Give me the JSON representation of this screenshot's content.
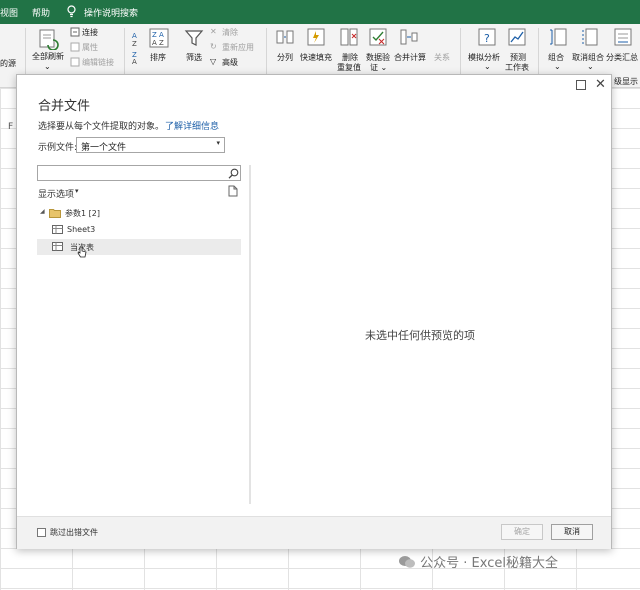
{
  "ribbon_tabs": [
    "视图",
    "帮助",
    "操作说明搜索"
  ],
  "ribbon": {
    "data_source_fragment": "的源",
    "refresh_all": "全部刷新",
    "refresh_dropdown": "⌄",
    "connections": "连接",
    "properties": "属性",
    "edit_links": "编辑链接",
    "sort": "排序",
    "filter": "筛选",
    "clear": "清除",
    "reapply": "重新应用",
    "advanced": "高级",
    "split": "分列",
    "flash_fill": "快速填充",
    "remove_duplicates_1": "删除",
    "remove_duplicates_2": "重复值",
    "data_validation_1": "数据验",
    "data_validation_2": "证 ⌄",
    "consolidate": "合并计算",
    "relationships": "关系",
    "what_if_1": "模拟分析",
    "what_if_2": "⌄",
    "forecast_1": "预测",
    "forecast_2": "工作表",
    "group_1": "组合",
    "group_2": "⌄",
    "ungroup_1": "取消组合",
    "ungroup_2": "⌄",
    "subtotal": "分类汇总",
    "outline_fragment": "级显示",
    "grid_col_fragment": "F"
  },
  "dialog": {
    "title": "合并文件",
    "description": "选择要从每个文件提取的对象。",
    "learn_more": "了解详细信息",
    "sample_file_label": "示例文件:",
    "sample_file_value": "第一个文件",
    "display_options": "显示选项",
    "tree": [
      {
        "label": "参数1 [2]",
        "type": "folder"
      },
      {
        "label": "Sheet3",
        "type": "sheet"
      },
      {
        "label": "当次表",
        "type": "sheet",
        "selected": true
      }
    ],
    "preview_empty": "未选中任何供预览的项",
    "skip_errors": "跳过出错文件",
    "ok": "确定",
    "cancel": "取消"
  },
  "watermark": "公众号 · Excel秘籍大全",
  "colors": {
    "ribbon_green": "#217346",
    "link_blue": "#1d5fa8"
  }
}
